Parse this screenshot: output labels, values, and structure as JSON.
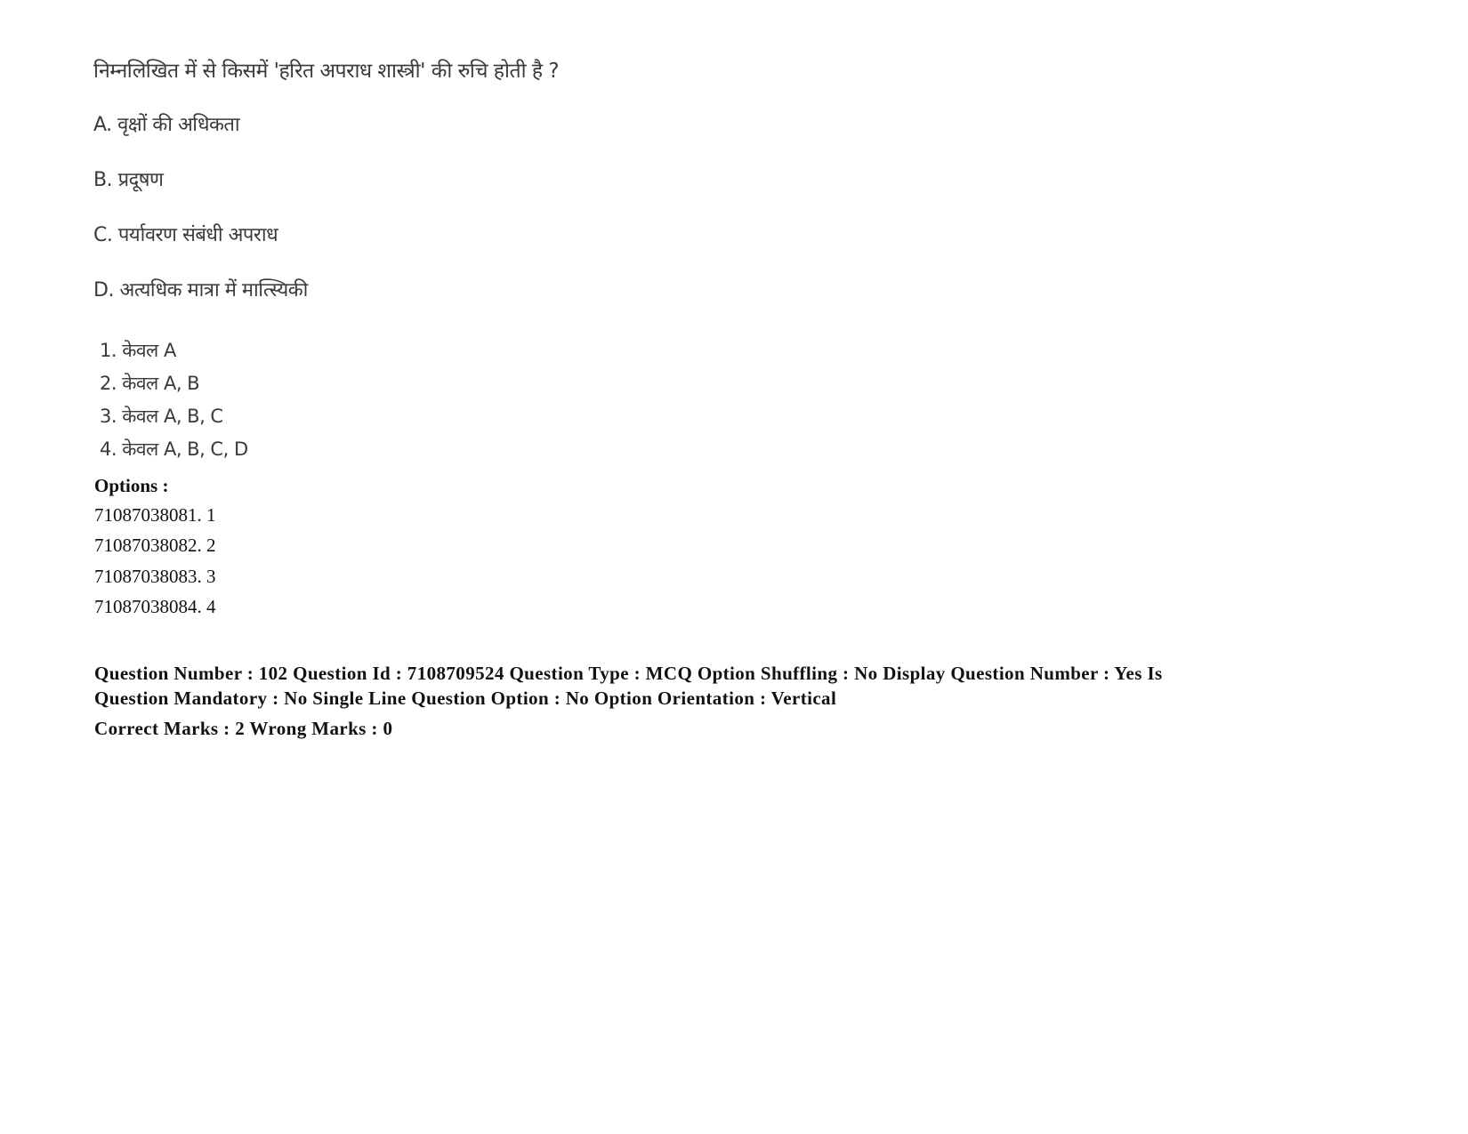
{
  "question": {
    "stem": "निम्नलिखित में से किसमें 'हरित अपराध शास्त्री' की रुचि होती है ?",
    "statements": [
      {
        "label": "A.",
        "text": "वृक्षों की अधिकता"
      },
      {
        "label": "B.",
        "text": "प्रदूषण"
      },
      {
        "label": "C.",
        "text": "पर्यावरण संबंधी अपराध"
      },
      {
        "label": "D.",
        "text": "अत्यधिक मात्रा में मात्स्यिकी"
      }
    ],
    "choices": [
      {
        "label": "1.",
        "text": "केवल A"
      },
      {
        "label": "2.",
        "text": "केवल A, B"
      },
      {
        "label": "3.",
        "text": "केवल A, B, C"
      },
      {
        "label": "4.",
        "text": "केवल A, B, C, D"
      }
    ]
  },
  "options": {
    "heading": "Options :",
    "items": [
      {
        "id": "71087038081.",
        "value": "1"
      },
      {
        "id": "71087038082.",
        "value": "2"
      },
      {
        "id": "71087038083.",
        "value": "3"
      },
      {
        "id": "71087038084.",
        "value": "4"
      }
    ]
  },
  "next_question_meta": {
    "line1": "Question Number : 102 Question Id : 7108709524 Question Type : MCQ Option Shuffling : No Display Question Number : Yes Is",
    "line2": "Question Mandatory : No Single Line Question Option : No Option Orientation : Vertical",
    "line3": "Correct Marks : 2 Wrong Marks : 0"
  }
}
